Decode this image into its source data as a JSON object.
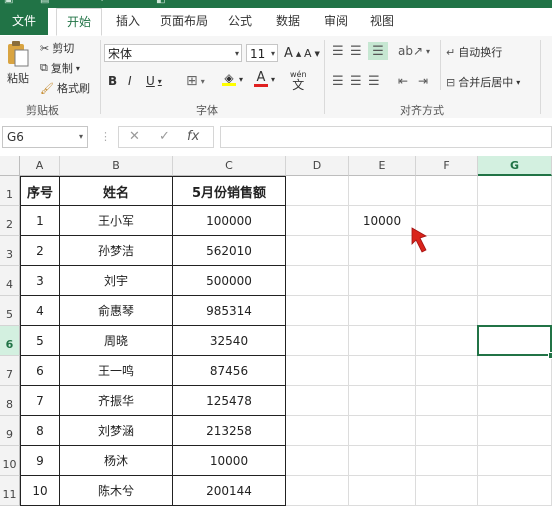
{
  "ribbon_tabs": [
    "文件",
    "开始",
    "插入",
    "页面布局",
    "公式",
    "数据",
    "审阅",
    "视图"
  ],
  "clipboard": {
    "paste": "粘贴",
    "cut": "剪切",
    "copy": "复制",
    "format_painter": "格式刷",
    "group": "剪贴板"
  },
  "font": {
    "name": "宋体",
    "size": "11",
    "bold": "B",
    "italic": "I",
    "underline": "U",
    "grow": "A",
    "shrink": "A",
    "wen": "wén",
    "group": "字体"
  },
  "alignment": {
    "wrap_text": "自动换行",
    "merge_center": "合并后居中",
    "group": "对齐方式"
  },
  "formula_bar": {
    "name_box": "G6",
    "cancel": "✕",
    "enter": "✓",
    "fx": "fx",
    "value": ""
  },
  "columns": [
    "A",
    "B",
    "C",
    "D",
    "E",
    "F",
    "G"
  ],
  "rows": [
    "1",
    "2",
    "3",
    "4",
    "5",
    "6",
    "7",
    "8",
    "9",
    "10",
    "11"
  ],
  "table": {
    "headers": [
      "序号",
      "姓名",
      "5月份销售额"
    ],
    "rows": [
      [
        "1",
        "王小军",
        "100000"
      ],
      [
        "2",
        "孙梦洁",
        "562010"
      ],
      [
        "3",
        "刘宇",
        "500000"
      ],
      [
        "4",
        "俞惠琴",
        "985314"
      ],
      [
        "5",
        "周晓",
        "32540"
      ],
      [
        "6",
        "王一鸣",
        "87456"
      ],
      [
        "7",
        "齐振华",
        "125478"
      ],
      [
        "8",
        "刘梦涵",
        "213258"
      ],
      [
        "9",
        "杨沐",
        "10000"
      ],
      [
        "10",
        "陈木兮",
        "200144"
      ]
    ]
  },
  "e2_value": "10000",
  "accent": "#217346"
}
